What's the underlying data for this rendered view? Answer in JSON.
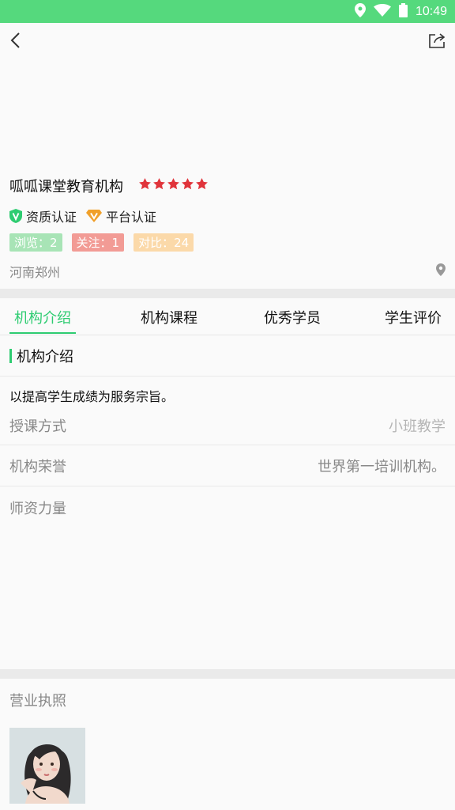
{
  "status_bar": {
    "time": "10:49"
  },
  "header": {
    "back_icon": "chevron-left-icon",
    "share_icon": "share-icon"
  },
  "org": {
    "name": "呱呱课堂教育机构",
    "rating": 5,
    "star_color": "#e0343b",
    "certs": [
      {
        "label": "资质认证",
        "icon": "shield-v-icon",
        "color": "#2ecc71"
      },
      {
        "label": "平台认证",
        "icon": "diamond-v-icon",
        "color": "#f0a02a"
      }
    ],
    "stats": {
      "views": "浏览：2",
      "follow": "关注：1",
      "compare": "对比：24"
    },
    "location": "河南郑州"
  },
  "tabs": [
    {
      "label": "机构介绍",
      "active": true
    },
    {
      "label": "机构课程",
      "active": false
    },
    {
      "label": "优秀学员",
      "active": false
    },
    {
      "label": "学生评价",
      "active": false
    }
  ],
  "intro": {
    "section_title": "机构介绍",
    "description": "以提高学生成绩为服务宗旨。",
    "rows": [
      {
        "label": "授课方式",
        "value": "小班教学"
      },
      {
        "label": "机构荣誉",
        "value": "世界第一培训机构。"
      },
      {
        "label": "师资力量",
        "value": ""
      }
    ]
  },
  "license": {
    "title": "营业执照"
  },
  "colors": {
    "accent": "#2ecc71",
    "status_bar": "#55d97d"
  }
}
